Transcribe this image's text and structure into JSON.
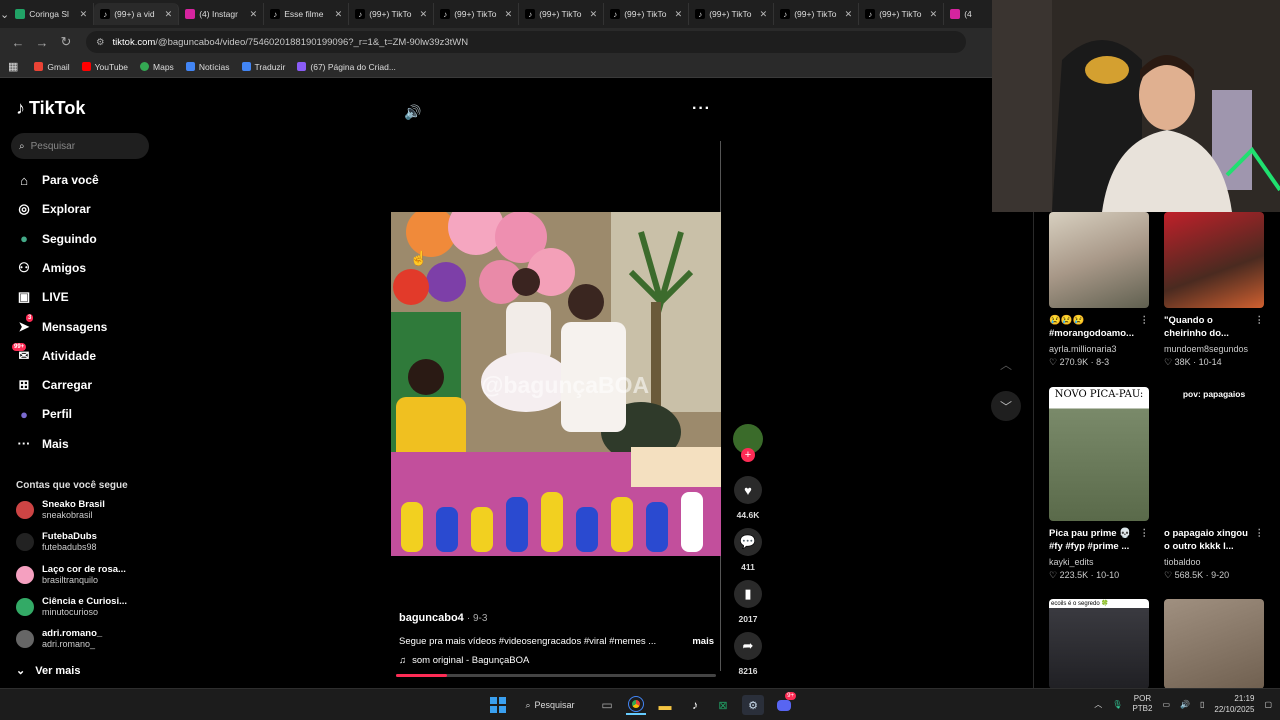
{
  "browser": {
    "tabs": [
      {
        "label": "Coringa Sl",
        "icon": "coringa-icon",
        "color": "#21a366"
      },
      {
        "label": "(99+) a vid",
        "icon": "tiktok-icon",
        "color": "#000"
      },
      {
        "label": "(4) Instagr",
        "icon": "instagram-icon",
        "color": "#d6249f"
      },
      {
        "label": "Esse filme",
        "icon": "tiktok-icon",
        "color": "#000"
      },
      {
        "label": "(99+) TikTo",
        "icon": "tiktok-icon",
        "color": "#000"
      },
      {
        "label": "(99+) TikTo",
        "icon": "tiktok-icon",
        "color": "#000"
      },
      {
        "label": "(99+) TikTo",
        "icon": "tiktok-icon",
        "color": "#000"
      },
      {
        "label": "(99+) TikTo",
        "icon": "tiktok-icon",
        "color": "#000"
      },
      {
        "label": "(99+) TikTo",
        "icon": "tiktok-icon",
        "color": "#000"
      },
      {
        "label": "(99+) TikTo",
        "icon": "tiktok-icon",
        "color": "#000"
      },
      {
        "label": "(99+) TikTo",
        "icon": "tiktok-icon",
        "color": "#000"
      },
      {
        "label": "(4",
        "icon": "instagram-icon",
        "color": "#d6249f"
      }
    ],
    "url_domain": "tiktok.com",
    "url_path": "/@baguncabo4/video/7546020188190199096?_r=1&_t=ZM-90lw39z3tWN",
    "bookmarks": [
      "Gmail",
      "YouTube",
      "Maps",
      "Notícias",
      "Traduzir",
      "(67) Página do Criad..."
    ]
  },
  "tiktok": {
    "logo": "TikTok",
    "search_placeholder": "Pesquisar",
    "nav": [
      {
        "label": "Para você",
        "icon": "home-icon"
      },
      {
        "label": "Explorar",
        "icon": "compass-icon"
      },
      {
        "label": "Seguindo",
        "icon": "following-avatar-icon"
      },
      {
        "label": "Amigos",
        "icon": "friends-icon"
      },
      {
        "label": "LIVE",
        "icon": "live-icon"
      },
      {
        "label": "Mensagens",
        "icon": "messages-icon",
        "badge": "3"
      },
      {
        "label": "Atividade",
        "icon": "activity-icon",
        "badge": "99+"
      },
      {
        "label": "Carregar",
        "icon": "upload-icon"
      },
      {
        "label": "Perfil",
        "icon": "profile-icon"
      },
      {
        "label": "Mais",
        "icon": "more-icon"
      }
    ],
    "following_header": "Contas que você segue",
    "following": [
      {
        "name": "Sneako Brasil",
        "handle": "sneakobrasil",
        "color": "#c44"
      },
      {
        "name": "FutebaDubs",
        "handle": "futebadubs98",
        "color": "#222"
      },
      {
        "name": "Laço cor de rosa...",
        "handle": "brasiltranquilo",
        "color": "#f5a0c0"
      },
      {
        "name": "Ciência e Curiosi...",
        "handle": "minutocurioso",
        "color": "#3a6"
      },
      {
        "name": "adri.romano_",
        "handle": "adri.romano_",
        "color": "#666"
      }
    ],
    "see_more": "Ver mais",
    "video": {
      "watermark": "@bagunçaBOA",
      "author": "baguncabo4",
      "date": "9-3",
      "caption": "Segue pra mais vídeos #videosengracados #viral #memes ...",
      "more": "mais",
      "music": "som original - BagunçaBOA",
      "progress": 0.16,
      "likes": "44.6K",
      "comments": "411",
      "saves": "2017",
      "shares": "8216"
    },
    "recommended": [
      {
        "title": "😢😢😢 #morangodoamo...",
        "user": "ayrla.millionaria3",
        "views": "270.9K",
        "date": "8-3",
        "theme": "money"
      },
      {
        "title": "\"Quando o cheirinho do...",
        "user": "mundoem8segundos",
        "views": "38K",
        "date": "10-14",
        "theme": "dog"
      },
      {
        "title": "Pica pau prime 💀 #fy #fyp #prime ...",
        "user": "kayki_edits",
        "views": "223.5K",
        "date": "10-10",
        "theme": "woody",
        "overlay": "NOVO PICA-PAU:"
      },
      {
        "title": "o papagaio xingou o outro kkkk l...",
        "user": "tiobaldoo",
        "views": "568.5K",
        "date": "9-20",
        "theme": "dark",
        "overlay": "pov: papagaios"
      },
      {
        "title": "",
        "user": "",
        "views": "",
        "date": "",
        "theme": "studio",
        "overlay": "ecoils é o segredo 🍀"
      },
      {
        "title": "",
        "user": "",
        "views": "",
        "date": "",
        "theme": "room"
      }
    ]
  },
  "taskbar": {
    "search_label": "Pesquisar",
    "discord_badge": "9+",
    "lang1": "POR",
    "lang2": "PTB2",
    "time": "21:19",
    "date": "22/10/2025"
  }
}
